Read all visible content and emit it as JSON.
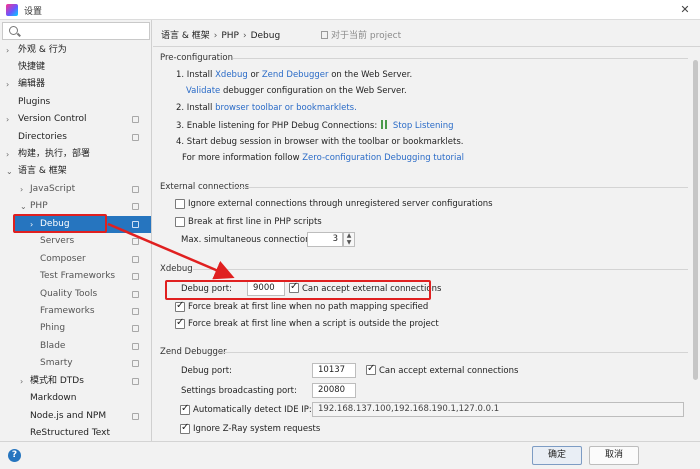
{
  "window": {
    "title": "设置",
    "close_glyph": "✕"
  },
  "sidebar": {
    "items": [
      {
        "label": "外观 & 行为",
        "arrow": "›"
      },
      {
        "label": "快捷键",
        "arrow": ""
      },
      {
        "label": "编辑器",
        "arrow": "›"
      },
      {
        "label": "Plugins",
        "arrow": ""
      },
      {
        "label": "Version Control",
        "arrow": "›"
      },
      {
        "label": "Directories",
        "arrow": ""
      },
      {
        "label": "构建，执行，部署",
        "arrow": "›"
      },
      {
        "label": "语言 & 框架",
        "arrow": "⌄"
      },
      {
        "label": "JavaScript",
        "arrow": "›"
      },
      {
        "label": "PHP",
        "arrow": "⌄"
      },
      {
        "label": "Debug",
        "arrow": "›"
      },
      {
        "label": "Servers",
        "arrow": ""
      },
      {
        "label": "Composer",
        "arrow": ""
      },
      {
        "label": "Test Frameworks",
        "arrow": ""
      },
      {
        "label": "Quality Tools",
        "arrow": ""
      },
      {
        "label": "Frameworks",
        "arrow": ""
      },
      {
        "label": "Phing",
        "arrow": ""
      },
      {
        "label": "Blade",
        "arrow": ""
      },
      {
        "label": "Smarty",
        "arrow": ""
      },
      {
        "label": "模式和 DTDs",
        "arrow": "›"
      },
      {
        "label": "Markdown",
        "arrow": ""
      },
      {
        "label": "Node.js and NPM",
        "arrow": ""
      },
      {
        "label": "ReStructured Text",
        "arrow": ""
      }
    ]
  },
  "breadcrumb": {
    "part1": "语言 & 框架",
    "part2": "PHP",
    "part3": "Debug",
    "separator": "›",
    "project_note": "对于当前 project"
  },
  "preconfig": {
    "title": "Pre-configuration",
    "step1_prefix": "1. Install",
    "xdebug_link": "Xdebug",
    "or_text": "or",
    "zend_link": "Zend Debugger",
    "step1_suffix": "on the Web Server.",
    "validate_link": "Validate",
    "validate_suffix": "debugger configuration on the Web Server.",
    "step2_prefix": "2. Install",
    "step2_link": "browser toolbar or bookmarklets.",
    "step3_text": "3. Enable listening for PHP Debug Connections:",
    "stop_listening_link": "Stop Listening",
    "step4_text": "4. Start debug session in browser with the toolbar or bookmarklets.",
    "more_info_text": "For more information follow",
    "tutorial_link": "Zero-configuration Debugging tutorial"
  },
  "external": {
    "title": "External connections",
    "ignore_label": "Ignore external connections through unregistered server configurations",
    "ignore_checked": false,
    "break_label": "Break at first line in PHP scripts",
    "break_checked": false,
    "max_label": "Max. simultaneous connections:",
    "max_value": "3"
  },
  "xdebug": {
    "title": "Xdebug",
    "port_label": "Debug port:",
    "port_value": "9000",
    "accept_label": "Can accept external connections",
    "accept_checked": true,
    "force_no_path_label": "Force break at first line when no path mapping specified",
    "force_no_path_checked": true,
    "force_outside_label": "Force break at first line when a script is outside the project",
    "force_outside_checked": true
  },
  "zend": {
    "title": "Zend Debugger",
    "port_label": "Debug port:",
    "port_value": "10137",
    "accept_label": "Can accept external connections",
    "accept_checked": true,
    "broadcast_label": "Settings broadcasting port:",
    "broadcast_value": "20080",
    "auto_ip_label": "Automatically detect IDE IP:",
    "auto_ip_checked": true,
    "ip_value": "192.168.137.100,192.168.190.1,127.0.0.1",
    "zray_label": "Ignore Z-Ray system requests",
    "zray_checked": true
  },
  "footer": {
    "help_glyph": "?",
    "ok_label": "确定",
    "cancel_label": "取消"
  },
  "colors": {
    "accent": "#2675bf",
    "link": "#2a6bc7",
    "annotation": "#e02020"
  }
}
